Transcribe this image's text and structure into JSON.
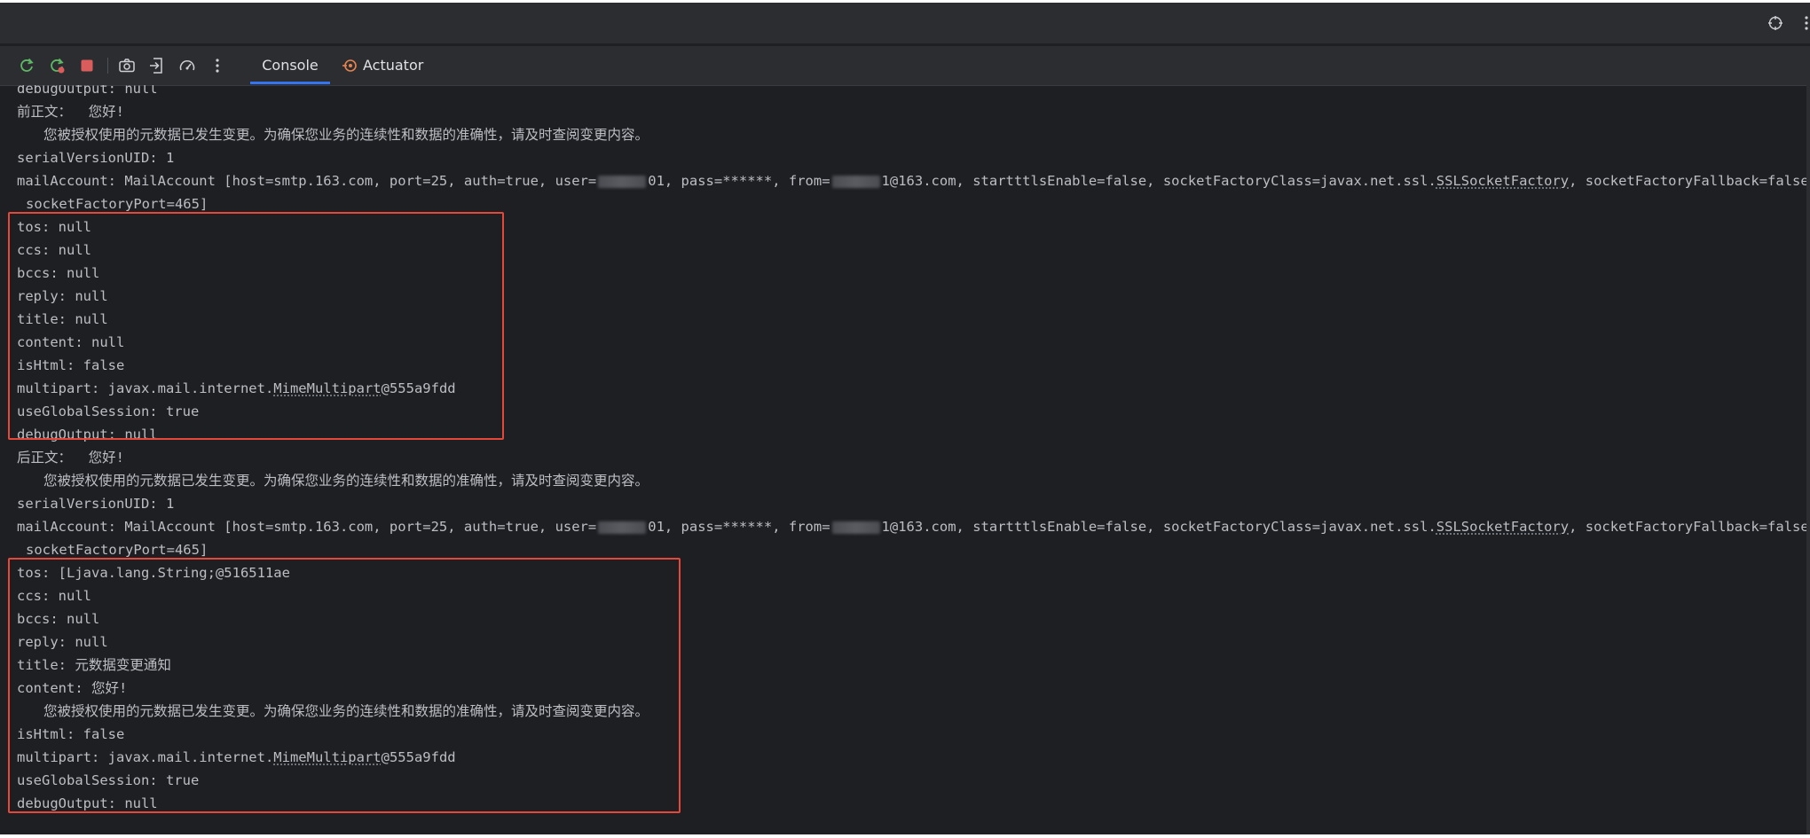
{
  "colors": {
    "background": "#1e1f22",
    "toolbar": "#2b2d30",
    "text": "#bcbec4",
    "highlight": "#e5473a",
    "tab_underline": "#3574f0",
    "stop_button": "#db5c5c",
    "rerun_button": "#5fb865"
  },
  "topbar": {
    "icons": [
      "crosshair-icon",
      "more-vertical-icon"
    ]
  },
  "toolbar": {
    "buttons": [
      "rerun-icon",
      "rerun-tests-icon",
      "stop-icon",
      "camera-icon",
      "exit-icon",
      "speedometer-icon",
      "more-vertical-icon"
    ],
    "tabs": [
      {
        "label": "Console",
        "active": true
      },
      {
        "label": "Actuator",
        "active": false,
        "icon": "actuator-icon"
      }
    ]
  },
  "console": {
    "lines": [
      "debugOutput: null",
      "前正文：  您好!",
      "您被授权使用的元数据已发生变更。为确保您业务的连续性和数据的准确性，请及时查阅变更内容。",
      "serialVersionUID: 1",
      {
        "p1": "mailAccount: MailAccount [host=smtp.163.com, port=25, auth=true, user=",
        "p2": "01, pass=******, from=",
        "p3": "1@163.com, startttlsEnable=false, socketFactoryClass=javax.net.ssl.",
        "u": "SSLSocketFactory",
        "p4": ", socketFactoryFallback=false,"
      },
      "socketFactoryPort=465]",
      "tos: null",
      "ccs: null",
      "bccs: null",
      "reply: null",
      "title: null",
      "content: null",
      "isHtml: false",
      {
        "p1": "multipart: javax.mail.internet.",
        "u": "MimeMultipart",
        "p2": "@555a9fdd"
      },
      "useGlobalSession: true",
      "debugOutput: null",
      "后正文：  您好!",
      "您被授权使用的元数据已发生变更。为确保您业务的连续性和数据的准确性，请及时查阅变更内容。",
      "serialVersionUID: 1",
      {
        "p1": "mailAccount: MailAccount [host=smtp.163.com, port=25, auth=true, user=",
        "p2": "01, pass=******, from=",
        "p3": "1@163.com, startttlsEnable=false, socketFactoryClass=javax.net.ssl.",
        "u": "SSLSocketFactory",
        "p4": ", socketFactoryFallback=false,"
      },
      "socketFactoryPort=465]",
      "tos: [Ljava.lang.String;@516511ae",
      "ccs: null",
      "bccs: null",
      "reply: null",
      "title: 元数据变更通知",
      "content: 您好!",
      "您被授权使用的元数据已发生变更。为确保您业务的连续性和数据的准确性，请及时查阅变更内容。",
      "isHtml: false",
      {
        "p1": "multipart: javax.mail.internet.",
        "u": "MimeMultipart",
        "p2": "@555a9fdd"
      },
      "useGlobalSession: true",
      "debugOutput: null"
    ]
  }
}
